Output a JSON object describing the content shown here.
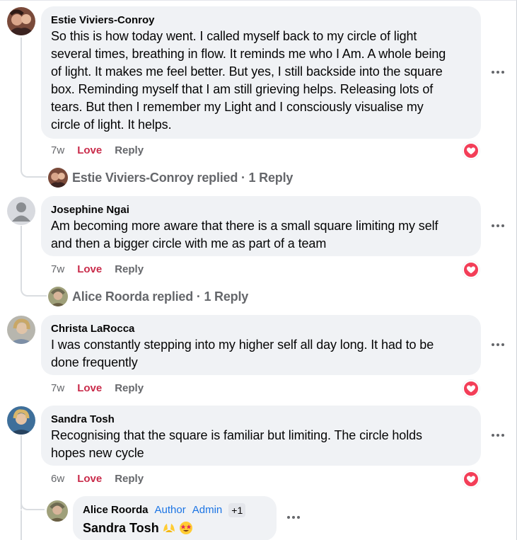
{
  "comments": [
    {
      "author": "Estie Viviers-Conroy",
      "lines": [
        "So this is how today went. I called myself back to my circle of light",
        "several times, breathing in flow. It reminds me who I Am. A whole being",
        "of light. It makes me feel better. But yes, I still backside into the square",
        "box. Reminding myself that I am still grieving helps. Releasing lots of",
        "tears. But then I remember my Light and I consciously visualise my",
        "circle of light. It helps."
      ],
      "time": "7w",
      "love": "Love",
      "reply": "Reply",
      "replied": "Estie Viviers-Conroy replied · 1 Reply"
    },
    {
      "author": "Josephine Ngai",
      "lines": [
        "Am becoming more aware that there is a small square limiting my self",
        "and then a bigger circle with me as part of a team"
      ],
      "time": "7w",
      "love": "Love",
      "reply": "Reply",
      "replied": "Alice Roorda replied · 1 Reply"
    },
    {
      "author": "Christa LaRocca",
      "lines": [
        "I was constantly stepping into my higher self all day long. It had to be",
        "done frequently"
      ],
      "time": "7w",
      "love": "Love",
      "reply": "Reply"
    },
    {
      "author": "Sandra Tosh",
      "lines": [
        "Recognising that the square is familiar but limiting. The circle holds",
        "hopes new cycle"
      ],
      "time": "6w",
      "love": "Love",
      "reply": "Reply"
    }
  ],
  "nested_reply": {
    "author": "Alice Roorda",
    "badge_author": "Author",
    "badge_admin": "Admin",
    "badge_more": "+1",
    "text": "Sandra Tosh"
  },
  "icons": {
    "more": "more-horizontal-icon",
    "reaction": "love-reaction-icon",
    "default_avatar": "default-avatar-icon"
  },
  "colors": {
    "love": "#c92b4a",
    "reaction_bg": "#f33e58",
    "badge": "#1b74e4",
    "bubble": "#f0f2f5"
  }
}
